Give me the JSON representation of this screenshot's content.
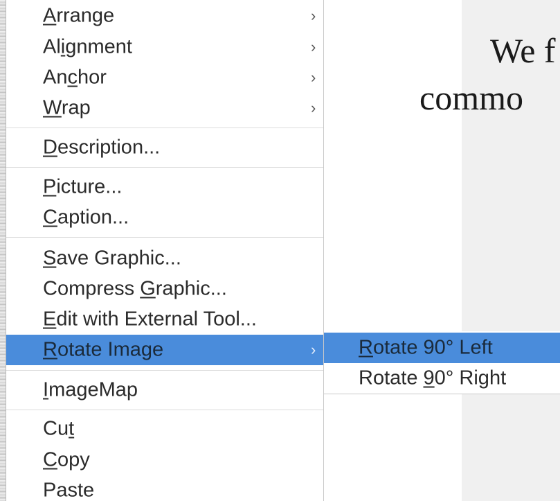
{
  "document": {
    "line1": "We f",
    "line2": "commo"
  },
  "context_menu": {
    "items": [
      {
        "pre": "",
        "ul": "A",
        "post": "rrange",
        "submenu": true
      },
      {
        "pre": "Al",
        "ul": "i",
        "post": "gnment",
        "submenu": true
      },
      {
        "pre": "An",
        "ul": "c",
        "post": "hor",
        "submenu": true
      },
      {
        "pre": "",
        "ul": "W",
        "post": "rap",
        "submenu": true
      },
      {
        "pre": "",
        "ul": "D",
        "post": "escription...",
        "submenu": false
      },
      {
        "pre": "",
        "ul": "P",
        "post": "icture...",
        "submenu": false
      },
      {
        "pre": "",
        "ul": "C",
        "post": "aption...",
        "submenu": false
      },
      {
        "pre": "",
        "ul": "S",
        "post": "ave Graphic...",
        "submenu": false
      },
      {
        "pre": "Compress ",
        "ul": "G",
        "post": "raphic...",
        "submenu": false
      },
      {
        "pre": "",
        "ul": "E",
        "post": "dit with External Tool...",
        "submenu": false
      },
      {
        "pre": "",
        "ul": "R",
        "post": "otate Image",
        "submenu": true,
        "highlighted": true
      },
      {
        "pre": "",
        "ul": "I",
        "post": "mageMap",
        "submenu": false
      },
      {
        "pre": "Cu",
        "ul": "t",
        "post": "",
        "submenu": false
      },
      {
        "pre": "",
        "ul": "C",
        "post": "opy",
        "submenu": false
      },
      {
        "pre": "Paste",
        "ul": "",
        "post": "",
        "submenu": false
      }
    ],
    "submenu_arrow": "›"
  },
  "rotate_submenu": {
    "items": [
      {
        "pre": "",
        "ul": "R",
        "post": "otate 90° Left",
        "highlighted": true
      },
      {
        "pre": "Rotate ",
        "ul": "9",
        "post": "0° Right",
        "highlighted": false
      }
    ]
  },
  "colors": {
    "highlight": "#4a8cdb",
    "menu_bg": "#ffffff",
    "separator": "#dcdcdc"
  }
}
